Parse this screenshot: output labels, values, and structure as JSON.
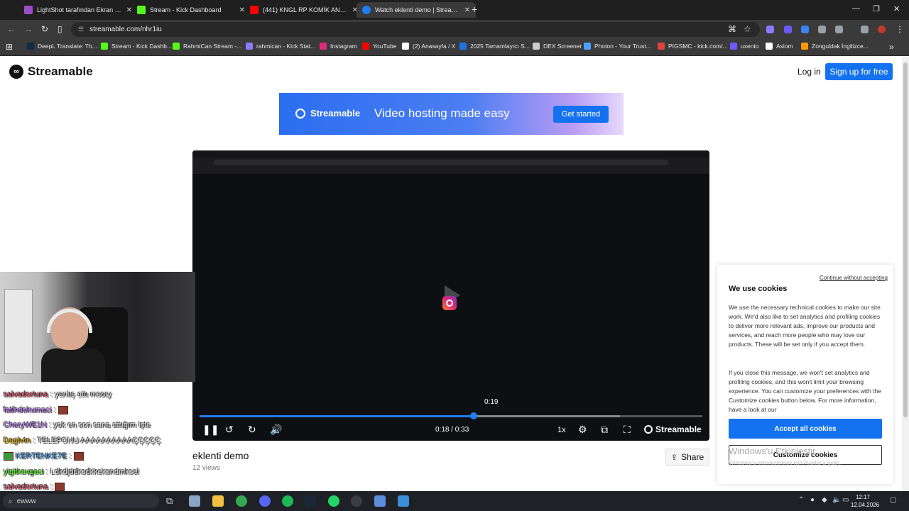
{
  "browser": {
    "tabs": [
      {
        "label": "LightShot tarafından Ekran Görü",
        "color": "#9b4dca"
      },
      {
        "label": "Stream - Kick Dashboard",
        "color": "#53fc18"
      },
      {
        "label": "(441) KNGL RP KOMİK ANLAR",
        "color": "#ff0000"
      },
      {
        "label": "Watch eklenti demo | Streamable",
        "color": "#1e7ef2"
      }
    ],
    "new_tab_glyph": "+",
    "url": "streamable.com/nhr1iu",
    "bookmarks": [
      {
        "label": "DeepL Translate: Th...",
        "color": "#0f2b46"
      },
      {
        "label": "Stream - Kick Dashb...",
        "color": "#53fc18"
      },
      {
        "label": "RahmiCan Stream -...",
        "color": "#53fc18"
      },
      {
        "label": "rahmican - Kick Stat...",
        "color": "#8a7cff"
      },
      {
        "label": "Instagram",
        "color": "#dd2a7b"
      },
      {
        "label": "YouTube",
        "color": "#ff0000"
      },
      {
        "label": "(2) Anasayfa / X",
        "color": "#ffffff"
      },
      {
        "label": "2025 Tamamlayıcı S...",
        "color": "#1a73e8"
      },
      {
        "label": "DEX Screener",
        "color": "#cccccc"
      },
      {
        "label": "Photon - Your Trust...",
        "color": "#4aa3ff"
      },
      {
        "label": "PIGSMC - kick.com/...",
        "color": "#e0443a"
      },
      {
        "label": "uxento",
        "color": "#6b5bff"
      },
      {
        "label": "Axiom",
        "color": "#ffffff"
      },
      {
        "label": "Zonguldak İngilizce...",
        "color": "#ff9800"
      }
    ]
  },
  "site": {
    "logo_text": "Streamable",
    "login": "Log in",
    "signup": "Sign up for free",
    "banner": {
      "brand": "Streamable",
      "tagline": "Video hosting made easy",
      "cta": "Get started"
    },
    "player": {
      "hover_time": "0:19",
      "time_readout": "0:18 / 0:33",
      "speed": "1x",
      "brand": "Streamable",
      "progress_fraction": 0.545,
      "buffered_fraction": 0.836
    },
    "video_title": "eklenti demo",
    "views": "12 views",
    "share": "Share"
  },
  "cookie": {
    "continue_without": "Continue without accepting",
    "heading": "We use cookies",
    "para1": "We use the necessary technical cookies to make our site work. We'd also like to set analytics and profiling cookies to deliver more relevant ads, improve our products and services, and reach more people who may love our products. These will be set only if you accept them.",
    "para2": "If you close this message, we won't set analytics and profiling cookies, and this won't limit your browsing experience. You can customize your preferences with the Customize cookies button below. For more information, have a look at our",
    "accept": "Accept all cookies",
    "customize": "Customize cookies"
  },
  "watermark": {
    "line1": "Windows'u Etkinleştir",
    "line2": "Windows'u etkinleştirmek için Ayarlar'a gidin."
  },
  "chat": [
    {
      "user": "salvadortuna",
      "color": "#e84a6a",
      "text": ": yanlış attı msory",
      "emote": false
    },
    {
      "user": "fatihdokumaci",
      "color": "#c07cff",
      "text": ":",
      "emote": true
    },
    {
      "user": "CheryWE1N",
      "color": "#c07cff",
      "text": ": yok en son sana attığım işte",
      "emote": false
    },
    {
      "user": "Dagh4n",
      "color": "#e0b000",
      "text": ": TELEFONU AAAAAAAAAAÇÇÇÇÇ",
      "emote": false
    },
    {
      "user": "KERTENKE7E",
      "color": "#4aa3ff",
      "text": ":",
      "emote": true
    },
    {
      "user": "yigitkavgaci",
      "color": "#53fc18",
      "text": ": Ldkdjddksdkkeksndmksel",
      "emote": false
    },
    {
      "user": "salvadortuna",
      "color": "#e84a6a",
      "text": ":",
      "emote": true
    }
  ],
  "taskbar": {
    "search_text": "ewww",
    "clock_time": "12:17",
    "clock_date": "12.04.2026"
  }
}
